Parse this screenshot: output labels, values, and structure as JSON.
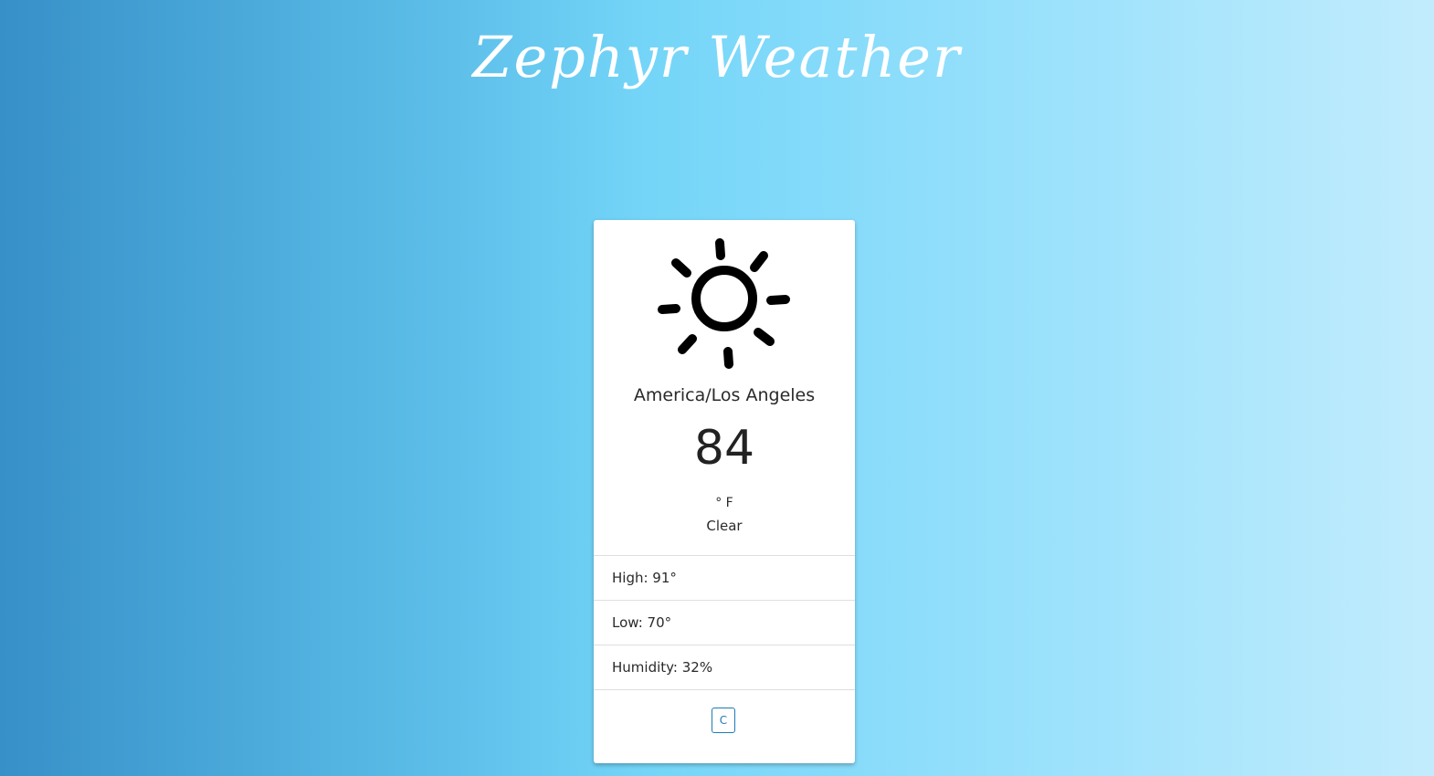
{
  "app": {
    "title": "Zephyr Weather"
  },
  "weather": {
    "icon": "sun-icon",
    "location": "America/Los Angeles",
    "temperature": "84",
    "unit": "° F",
    "condition": "Clear"
  },
  "details": [
    {
      "label": "High: 91°"
    },
    {
      "label": "Low: 70°"
    },
    {
      "label": "Humidity: 32%"
    }
  ],
  "controls": {
    "unit_toggle_label": "C"
  },
  "colors": {
    "gradient_left": "#3790c8",
    "gradient_right": "#c2ecfd",
    "button_accent": "#1f7ab5",
    "card_background": "#ffffff"
  }
}
